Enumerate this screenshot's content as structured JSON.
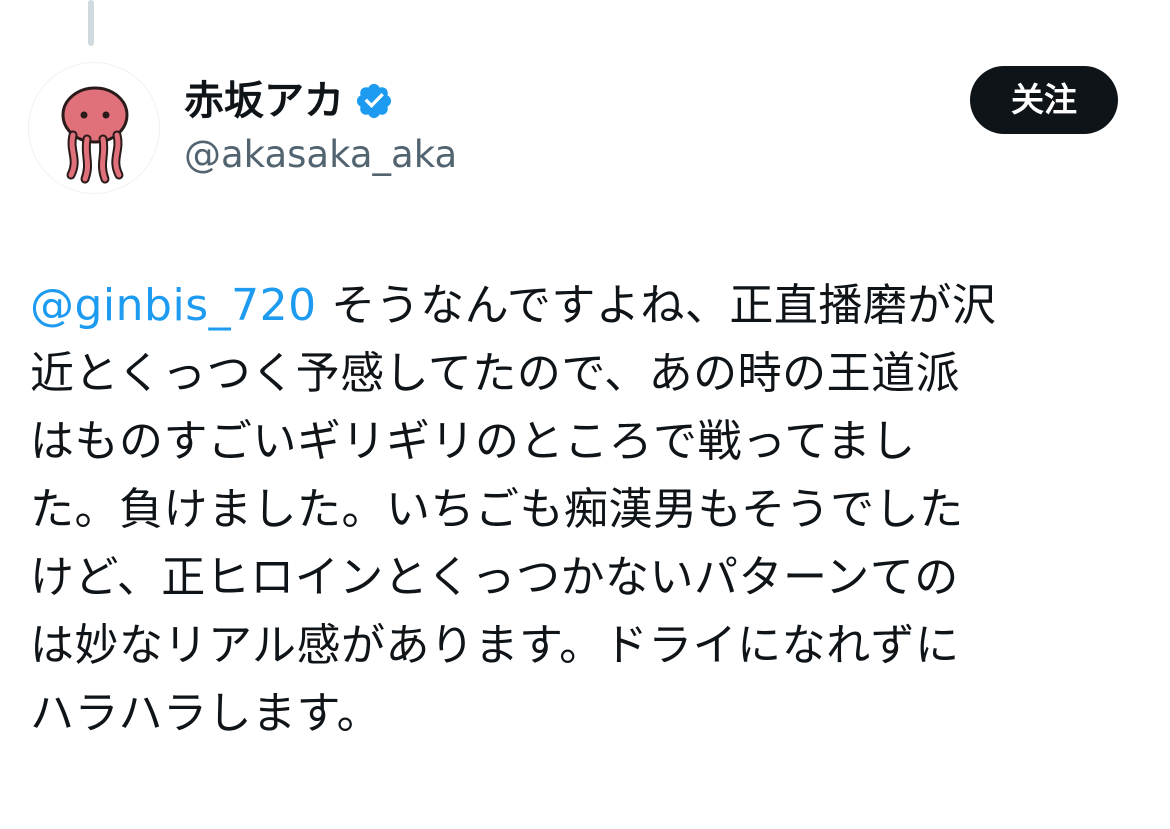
{
  "user": {
    "display_name": "赤坂アカ",
    "handle": "@akasaka_aka",
    "verified_icon": "verified-badge-icon",
    "avatar_icon": "octopus-avatar-icon"
  },
  "follow_button": {
    "label": "关注"
  },
  "tweet": {
    "mention": "@ginbis_720",
    "first_line_rest": " そうなんですよね、正直播磨が沢",
    "lines": [
      "近とくっつく予感してたので、あの時の王道派",
      "はものすごいギリギリのところで戦ってまし",
      "た。負けました。いちごも痴漢男もそうでした",
      "けど、正ヒロインとくっつかないパターンての",
      "は妙なリアル感があります。ドライになれずに",
      "ハラハラします。"
    ]
  },
  "colors": {
    "accent": "#1d9bf0",
    "text": "#0f1419",
    "secondary_text": "#536471",
    "button_bg": "#0f1419",
    "avatar_octopus": "#e0707a"
  }
}
